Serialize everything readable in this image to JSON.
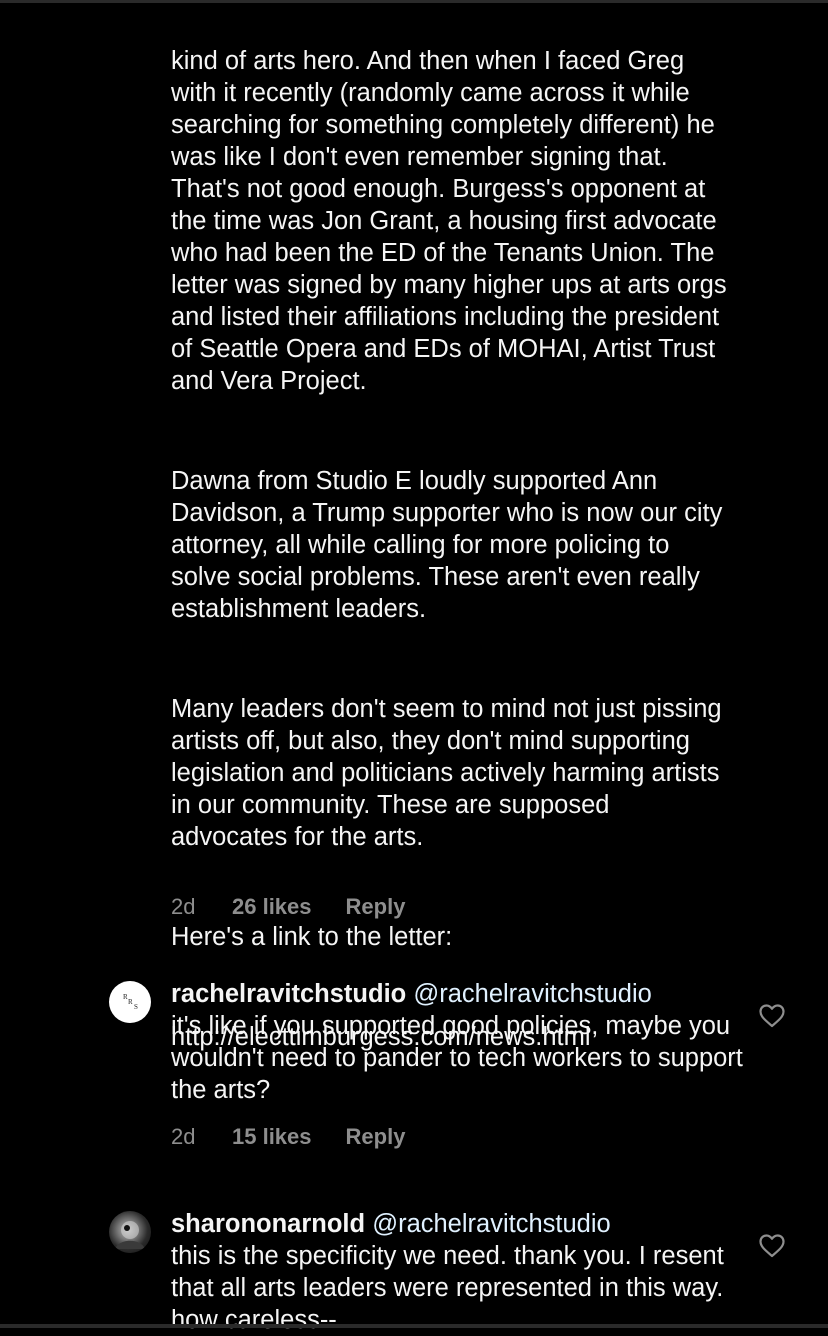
{
  "thread": {
    "first_comment": {
      "paragraphs": [
        "kind of arts hero. And then when I faced Greg with it recently (randomly came across it while searching for something completely different) he was like I don't even remember signing that. That's not good enough. Burgess's opponent at the time was Jon Grant, a housing first advocate who had been the ED of the Tenants Union. The letter was signed by many higher ups at arts orgs and listed their affiliations including the president of Seattle Opera and EDs of MOHAI, Artist Trust and Vera Project.",
        "Dawna from Studio E loudly supported Ann Davidson, a Trump supporter who is now our city attorney, all while calling for more policing to solve social problems. These aren't even really establishment leaders.",
        "Many leaders don't seem to mind not just pissing artists off, but also, they don't mind supporting legislation and politicians actively harming artists in our community. These are supposed advocates for the arts.",
        "Here's a link to the letter:",
        "http://electtimburgess.com/news.html"
      ],
      "time": "2d",
      "likes": "26 likes",
      "reply": "Reply"
    },
    "replies": [
      {
        "username": "rachelravitchstudio",
        "mention": "@rachelravitchstudio",
        "text": "it's like if you supported good policies, maybe you wouldn't need to pander to tech workers to support the arts?",
        "time": "2d",
        "likes": "15 likes",
        "reply": "Reply",
        "avatar_text": "R R S",
        "avatar_icon": "rrs-logo-avatar"
      },
      {
        "username": "sharononarnold",
        "mention": "@rachelravitchstudio",
        "text": "this is the specificity we need. thank you. I resent that all arts leaders were represented in this way. how careless--",
        "avatar_icon": "photo-avatar"
      }
    ]
  },
  "icons": {
    "like": "heart-outline-icon"
  },
  "colors": {
    "background": "#000000",
    "text": "#f5f5f5",
    "meta": "#8e8e8e"
  }
}
